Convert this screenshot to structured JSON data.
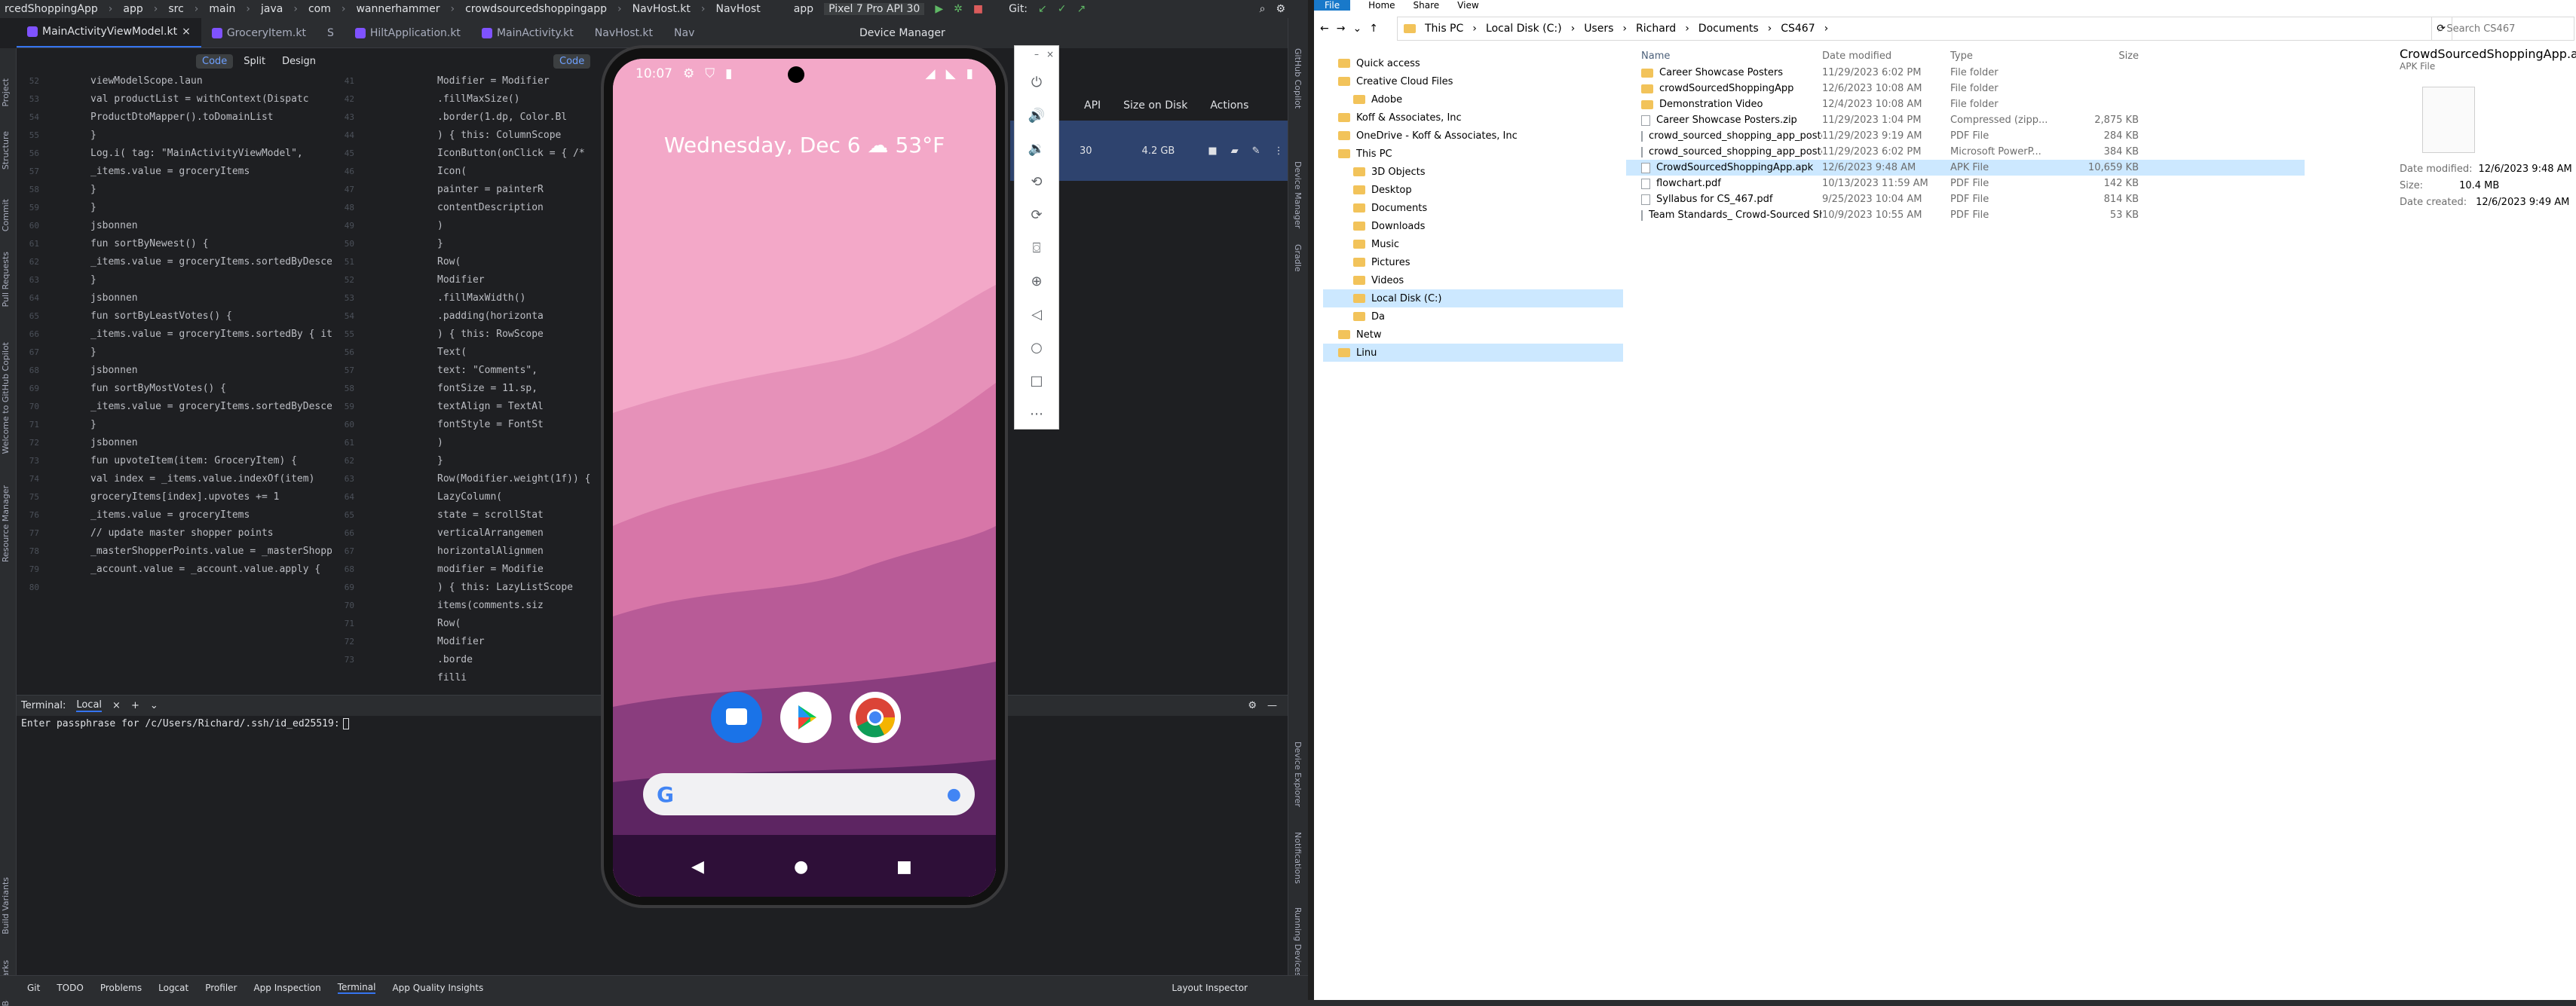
{
  "ide": {
    "menu": [
      "rcedShoppingApp",
      "app",
      "src",
      "main",
      "java",
      "com",
      "wannerhammer",
      "crowdsourcedshoppingapp",
      "NavHost.kt",
      "NavHost",
      "app",
      "Pixel 7 Pro API 30",
      "Git:"
    ],
    "tabs": [
      "MainActivityViewModel.kt",
      "GroceryItem.kt",
      "S",
      "HiltApplication.kt",
      "MainActivity.kt",
      "NavHost.kt",
      "Nav"
    ],
    "device_manager_title": "Device Manager",
    "mode_tabs": [
      "Code",
      "Split",
      "Design"
    ],
    "mode_code2": "Code",
    "dm_columns": [
      "API",
      "Size on Disk",
      "Actions"
    ],
    "dm_row": {
      "api": "30",
      "size": "4.2 GB"
    },
    "left_tools": [
      "Project",
      "Structure",
      "Commit",
      "Pull Requests",
      "Welcome to GitHub Copilot",
      "Resource Manager",
      "Build Variants",
      "Bookmarks"
    ],
    "right_tools": [
      "Gradle",
      "Device Manager",
      "Notifications",
      "Device Explorer",
      "Running Devices",
      "GitHub Copilot"
    ],
    "left_code": [
      {
        "t": "viewModelScope.laun"
      },
      {
        "t": "val productList = withContext(Dispatc"
      },
      {
        "t": "ProductDtoMapper().toDomainList"
      },
      {
        "t": "}"
      },
      {
        "t": "Log.i( tag: \"MainActivityViewModel\","
      },
      {
        "t": "_items.value = groceryItems"
      },
      {
        "t": "}"
      },
      {
        "t": ""
      },
      {
        "t": "}"
      },
      {
        "t": ""
      },
      {
        "t": "jsbonnen"
      },
      {
        "t": "fun sortByNewest() {"
      },
      {
        "t": "_items.value = groceryItems.sortedByDesce"
      },
      {
        "t": "}"
      },
      {
        "t": ""
      },
      {
        "t": "jsbonnen"
      },
      {
        "t": "fun sortByLeastVotes() {"
      },
      {
        "t": "_items.value = groceryItems.sortedBy { it"
      },
      {
        "t": "}"
      },
      {
        "t": ""
      },
      {
        "t": "jsbonnen"
      },
      {
        "t": "fun sortByMostVotes() {"
      },
      {
        "t": "_items.value = groceryItems.sortedByDesce"
      },
      {
        "t": "}"
      },
      {
        "t": ""
      },
      {
        "t": "jsbonnen"
      },
      {
        "t": "fun upvoteItem(item: GroceryItem) {"
      },
      {
        "t": "val index = _items.value.indexOf(item)"
      },
      {
        "t": "groceryItems[index].upvotes += 1"
      },
      {
        "t": "_items.value = groceryItems"
      },
      {
        "t": "// update master shopper points"
      },
      {
        "t": "_masterShopperPoints.value = _masterShopp"
      },
      {
        "t": "_account.value = _account.value.apply {"
      }
    ],
    "left_line_numbers": [
      "52",
      "53",
      "54",
      "55",
      "56",
      "57",
      "58",
      "59",
      "60",
      "61",
      "",
      "62",
      "63",
      "64",
      "65",
      "",
      "66",
      "67",
      "68",
      "69",
      "",
      "70",
      "71",
      "72",
      "73",
      "",
      "74",
      "75",
      "76",
      "77",
      "78",
      "79",
      "80"
    ],
    "mid_code": [
      {
        "t": "Modifier = Modifier"
      },
      {
        "t": ".fillMaxSize()"
      },
      {
        "t": ".border(1.dp, Color.Bl"
      },
      {
        "t": ") { this: ColumnScope"
      },
      {
        "t": "IconButton(onClick = { /*"
      },
      {
        "t": "Icon("
      },
      {
        "t": "painter = painterR"
      },
      {
        "t": "contentDescription"
      },
      {
        "t": ")"
      },
      {
        "t": "}"
      },
      {
        "t": "Row("
      },
      {
        "t": "Modifier"
      },
      {
        "t": ".fillMaxWidth()"
      },
      {
        "t": ".padding(horizonta"
      },
      {
        "t": ") { this: RowScope"
      },
      {
        "t": "Text("
      },
      {
        "t": "text: \"Comments\","
      },
      {
        "t": "fontSize = 11.sp,"
      },
      {
        "t": "textAlign = TextAl"
      },
      {
        "t": "fontStyle = FontSt"
      },
      {
        "t": ")"
      },
      {
        "t": ""
      },
      {
        "t": "}"
      },
      {
        "t": "Row(Modifier.weight(1f)) {"
      },
      {
        "t": "LazyColumn("
      },
      {
        "t": "state = scrollStat"
      },
      {
        "t": "verticalArrangemen"
      },
      {
        "t": "horizontalAlignmen"
      },
      {
        "t": "modifier = Modifie"
      },
      {
        "t": ") { this: LazyListScope"
      },
      {
        "t": "items(comments.siz"
      },
      {
        "t": "Row("
      },
      {
        "t": "Modifier"
      },
      {
        "t": ".borde"
      },
      {
        "t": "filli"
      }
    ],
    "terminal_tabs": [
      "Terminal:",
      "Local"
    ],
    "terminal_line": "Enter passphrase for /c/Users/Richard/.ssh/id_ed25519:",
    "status_items": [
      "Git",
      "TODO",
      "Problems",
      "Logcat",
      "Profiler",
      "App Inspection",
      "Terminal",
      "App Quality Insights"
    ],
    "status_right": "Layout Inspector"
  },
  "emulator": {
    "time": "10:07",
    "date_weather": "Wednesday, Dec 6",
    "temp": "53°F",
    "tools": [
      "power-icon",
      "volume-up-icon",
      "volume-down-icon",
      "rotate-left-icon",
      "rotate-right-icon",
      "camera-icon",
      "zoom-icon",
      "back-icon",
      "home-icon",
      "overview-icon",
      "more-icon"
    ]
  },
  "explorer": {
    "ribbon": [
      "File",
      "Home",
      "Share",
      "View"
    ],
    "breadcrumb": [
      "This PC",
      "Local Disk (C:)",
      "Users",
      "Richard",
      "Documents",
      "CS467"
    ],
    "search_placeholder": "Search CS467",
    "nav": [
      {
        "label": "Quick access",
        "sel": false
      },
      {
        "label": "Creative Cloud Files",
        "sel": false
      },
      {
        "label": "Adobe",
        "sel": false
      },
      {
        "label": "Koff & Associates, Inc",
        "sel": false
      },
      {
        "label": "OneDrive - Koff & Associates, Inc",
        "sel": false
      },
      {
        "label": "This PC",
        "sel": false
      },
      {
        "label": "3D Objects",
        "sel": false
      },
      {
        "label": "Desktop",
        "sel": false
      },
      {
        "label": "Documents",
        "sel": false
      },
      {
        "label": "Downloads",
        "sel": false
      },
      {
        "label": "Music",
        "sel": false
      },
      {
        "label": "Pictures",
        "sel": false
      },
      {
        "label": "Videos",
        "sel": false
      },
      {
        "label": "Local Disk (C:)",
        "sel": true
      },
      {
        "label": "Da",
        "sel": false
      },
      {
        "label": "Netw",
        "sel": false
      },
      {
        "label": "Linu",
        "sel": true
      }
    ],
    "columns": [
      "Name",
      "Date modified",
      "Type",
      "Size"
    ],
    "files": [
      {
        "name": "Career Showcase Posters",
        "date": "11/29/2023 6:02 PM",
        "type": "File folder",
        "size": ""
      },
      {
        "name": "crowdSourcedShoppingApp",
        "date": "12/6/2023 10:08 AM",
        "type": "File folder",
        "size": ""
      },
      {
        "name": "Demonstration Video",
        "date": "12/4/2023 10:08 AM",
        "type": "File folder",
        "size": ""
      },
      {
        "name": "Career Showcase Posters.zip",
        "date": "11/29/2023 1:04 PM",
        "type": "Compressed (zipp...",
        "size": "2,875 KB"
      },
      {
        "name": "crowd_sourced_shopping_app_poster.pdf",
        "date": "11/29/2023 9:19 AM",
        "type": "PDF File",
        "size": "284 KB"
      },
      {
        "name": "crowd_sourced_shopping_app_poster.pptx",
        "date": "11/29/2023 6:02 PM",
        "type": "Microsoft PowerP...",
        "size": "384 KB"
      },
      {
        "name": "CrowdSourcedShoppingApp.apk",
        "date": "12/6/2023 9:48 AM",
        "type": "APK File",
        "size": "10,659 KB"
      },
      {
        "name": "flowchart.pdf",
        "date": "10/13/2023 11:59 AM",
        "type": "PDF File",
        "size": "142 KB"
      },
      {
        "name": "Syllabus for CS_467.pdf",
        "date": "9/25/2023 10:04 AM",
        "type": "PDF File",
        "size": "814 KB"
      },
      {
        "name": "Team Standards_ Crowd-Sourced Shoppi...",
        "date": "10/9/2023 10:55 AM",
        "type": "PDF File",
        "size": "53 KB"
      }
    ],
    "details": {
      "title": "CrowdSourcedShoppingApp.apk",
      "subtitle": "APK File",
      "date_modified_label": "Date modified:",
      "date_modified": "12/6/2023 9:48 AM",
      "size_label": "Size:",
      "size": "10.4 MB",
      "date_created_label": "Date created:",
      "date_created": "12/6/2023 9:49 AM"
    }
  }
}
